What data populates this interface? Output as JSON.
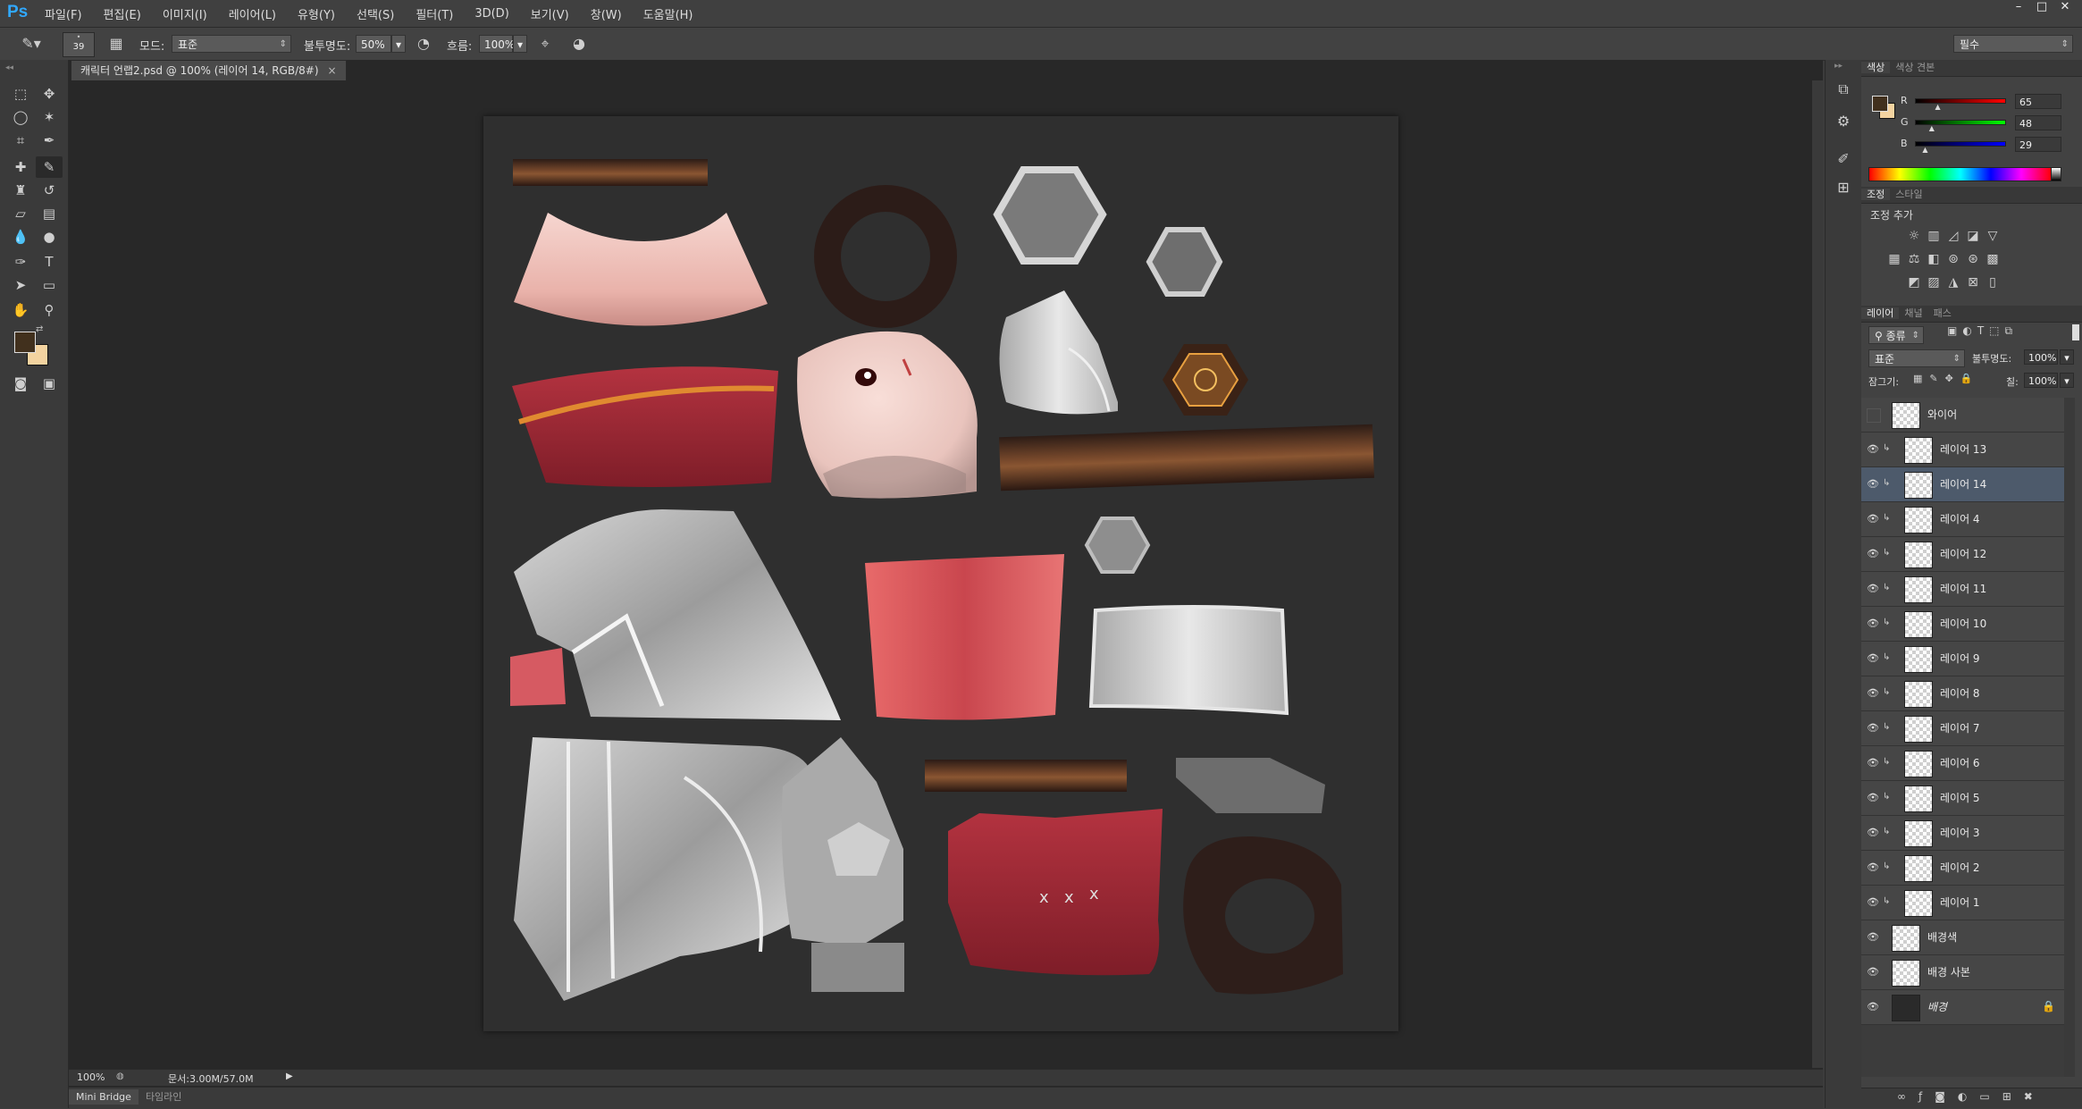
{
  "app": {
    "logo": "Ps",
    "menu": [
      "파일(F)",
      "편집(E)",
      "이미지(I)",
      "레이어(L)",
      "유형(Y)",
      "선택(S)",
      "필터(T)",
      "3D(D)",
      "보기(V)",
      "창(W)",
      "도움말(H)"
    ],
    "window_controls": [
      "–",
      "□",
      "✕"
    ]
  },
  "options_bar": {
    "brush_size": "39",
    "mode_label": "모드:",
    "mode_value": "표준",
    "opacity_label": "불투명도:",
    "opacity_value": "50%",
    "flow_label": "흐름:",
    "flow_value": "100%",
    "workspace": "필수"
  },
  "document": {
    "tab_title": "캐릭터 언랩2.psd @ 100% (레이어 14, RGB/8#)",
    "close": "×",
    "zoom": "100%",
    "doc_info": "문서:3.00M/57.0M"
  },
  "bottom_tabs": [
    "Mini Bridge",
    "타임라인"
  ],
  "color_panel": {
    "tabs": [
      "색상",
      "색상 견본"
    ],
    "channels": [
      {
        "label": "R",
        "value": "65",
        "fraction": 0.255
      },
      {
        "label": "G",
        "value": "48",
        "fraction": 0.188
      },
      {
        "label": "B",
        "value": "29",
        "fraction": 0.114
      }
    ],
    "foreground": "#41301d",
    "background": "#f3d3a0"
  },
  "adjust_panel": {
    "tabs": [
      "조정",
      "스타일"
    ],
    "title": "조정 추가"
  },
  "layers_panel": {
    "tabs": [
      "레이어",
      "채널",
      "패스"
    ],
    "filter": "종류",
    "blend": "표준",
    "opacity_label": "불투명도:",
    "opacity_value": "100%",
    "lock_label": "잠그기:",
    "fill_label": "칠:",
    "fill_value": "100%",
    "layers": [
      {
        "name": "와이어",
        "visible": false,
        "clip": false,
        "selected": false
      },
      {
        "name": "레이어 13",
        "visible": true,
        "clip": true,
        "selected": false
      },
      {
        "name": "레이어 14",
        "visible": true,
        "clip": true,
        "selected": true
      },
      {
        "name": "레이어 4",
        "visible": true,
        "clip": true,
        "selected": false
      },
      {
        "name": "레이어 12",
        "visible": true,
        "clip": true,
        "selected": false
      },
      {
        "name": "레이어 11",
        "visible": true,
        "clip": true,
        "selected": false
      },
      {
        "name": "레이어 10",
        "visible": true,
        "clip": true,
        "selected": false
      },
      {
        "name": "레이어 9",
        "visible": true,
        "clip": true,
        "selected": false
      },
      {
        "name": "레이어 8",
        "visible": true,
        "clip": true,
        "selected": false
      },
      {
        "name": "레이어 7",
        "visible": true,
        "clip": true,
        "selected": false
      },
      {
        "name": "레이어 6",
        "visible": true,
        "clip": true,
        "selected": false
      },
      {
        "name": "레이어 5",
        "visible": true,
        "clip": true,
        "selected": false
      },
      {
        "name": "레이어 3",
        "visible": true,
        "clip": true,
        "selected": false
      },
      {
        "name": "레이어 2",
        "visible": true,
        "clip": true,
        "selected": false
      },
      {
        "name": "레이어 1",
        "visible": true,
        "clip": true,
        "selected": false
      },
      {
        "name": "배경색",
        "visible": true,
        "clip": false,
        "selected": false
      },
      {
        "name": "배경 사본",
        "visible": true,
        "clip": false,
        "selected": false
      },
      {
        "name": "배경",
        "visible": true,
        "clip": false,
        "selected": false,
        "locked": true
      }
    ],
    "footer_icons": [
      "link-icon",
      "fx-icon",
      "mask-icon",
      "adjustment-icon",
      "group-icon",
      "new-layer-icon",
      "trash-icon"
    ]
  }
}
